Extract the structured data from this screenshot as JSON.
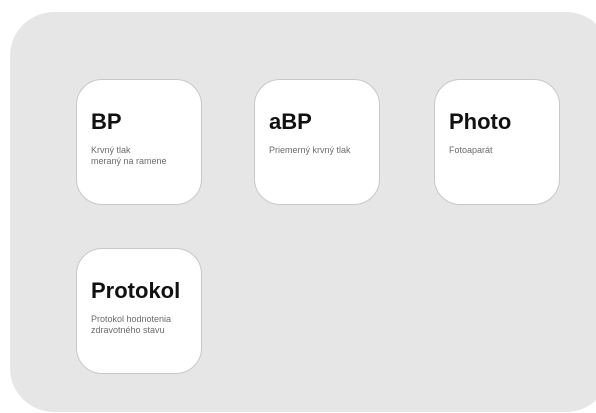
{
  "tiles": [
    {
      "title": "BP",
      "description": "Krvný tlak\nmeraný na ramene"
    },
    {
      "title": "aBP",
      "description": "Priemerný krvný tlak"
    },
    {
      "title": "Photo",
      "description": "Fotoaparát"
    },
    {
      "title": "Protokol",
      "description": "Protokol hodnotenia\nzdravotného stavu"
    }
  ]
}
